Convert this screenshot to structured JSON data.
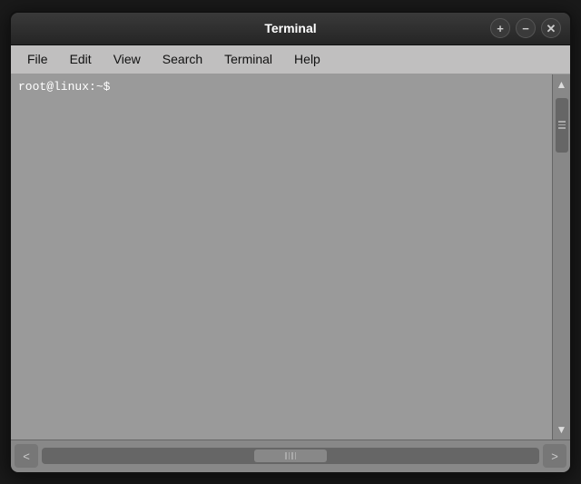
{
  "titlebar": {
    "title": "Terminal",
    "btn_add": "+",
    "btn_minimize": "−",
    "btn_close": "✕"
  },
  "menubar": {
    "items": [
      "File",
      "Edit",
      "View",
      "Search",
      "Terminal",
      "Help"
    ]
  },
  "terminal": {
    "prompt": "root@linux:~$"
  },
  "scrollbar": {
    "arrow_up": "▲",
    "arrow_down": "▼",
    "arrow_left": "<",
    "arrow_right": ">"
  }
}
